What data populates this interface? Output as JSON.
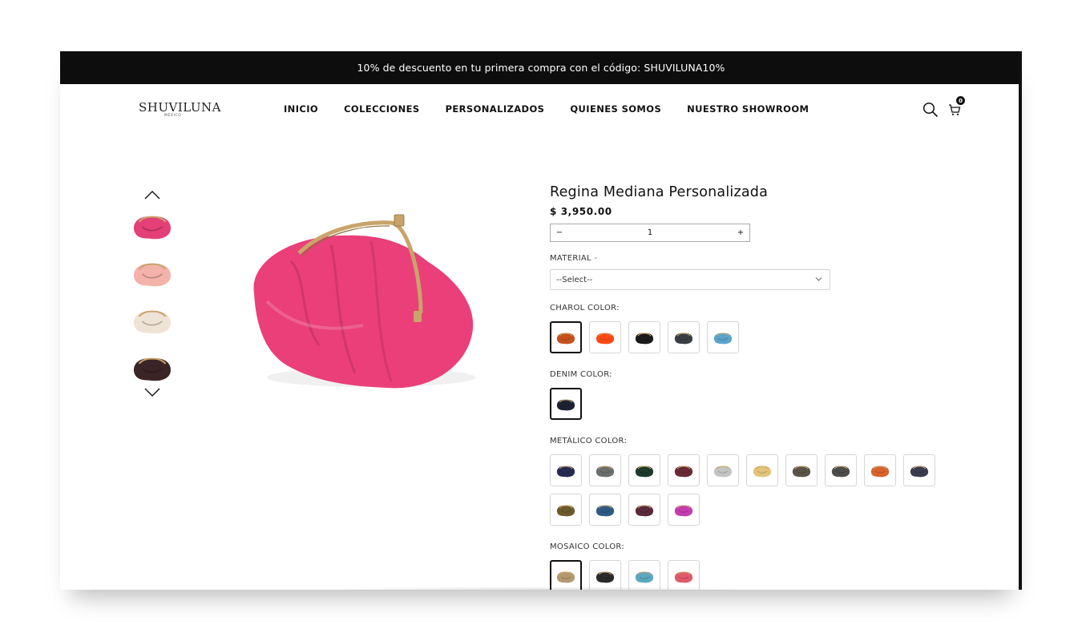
{
  "promo": {
    "text": "10% de descuento en tu primera compra con el código: SHUVILUNA10%"
  },
  "header": {
    "logo": "SHUVILUNA",
    "logo_sub": "MÉXICO",
    "nav": [
      "INICIO",
      "COLECCIONES",
      "PERSONALIZADOS",
      "QUIENES SOMOS",
      "NUESTRO SHOWROOM"
    ],
    "cart_count": "0",
    "icons": [
      "search-icon",
      "cart-icon"
    ]
  },
  "gallery": {
    "thumb_colors": [
      "#e43f77",
      "#f3b3aa",
      "#efe3d6",
      "#3b2426"
    ],
    "main_color": "#ea3f78",
    "frame_color": "#c9a46a"
  },
  "product": {
    "title": "Regina Mediana Personalizada",
    "price": "$ 3,950.00",
    "quantity": "1",
    "minus": "−",
    "plus": "+"
  },
  "material": {
    "label": "MATERIAL",
    "optional": " -",
    "selected": "--Select--"
  },
  "charol": {
    "label": "CHAROL COLOR:",
    "colors": [
      "#c5511e",
      "#ff4a12",
      "#1a1a1a",
      "#3a3e42",
      "#5aa4cc"
    ],
    "selected_index": 0
  },
  "denim": {
    "label": "DENIM COLOR:",
    "colors": [
      "#1d2233"
    ],
    "selected_index": 0
  },
  "metalico": {
    "label": "METÁLICO COLOR:",
    "colors": [
      "#262a52",
      "#6a6e6c",
      "#1e3a2c",
      "#6a2a35",
      "#c4c4c4",
      "#e4c37a",
      "#5a5448",
      "#4c4d4a",
      "#d8632e",
      "#3a3c50",
      "#6c5a2a",
      "#2e5a82",
      "#5a2a3a",
      "#c23cb0"
    ],
    "selected_index": -1
  },
  "mosaico": {
    "label": "MOSAICO COLOR:",
    "colors": [
      "#b59a70",
      "#2a2a2a",
      "#5ba8c0",
      "#e05a6a"
    ],
    "selected_index": 0
  }
}
